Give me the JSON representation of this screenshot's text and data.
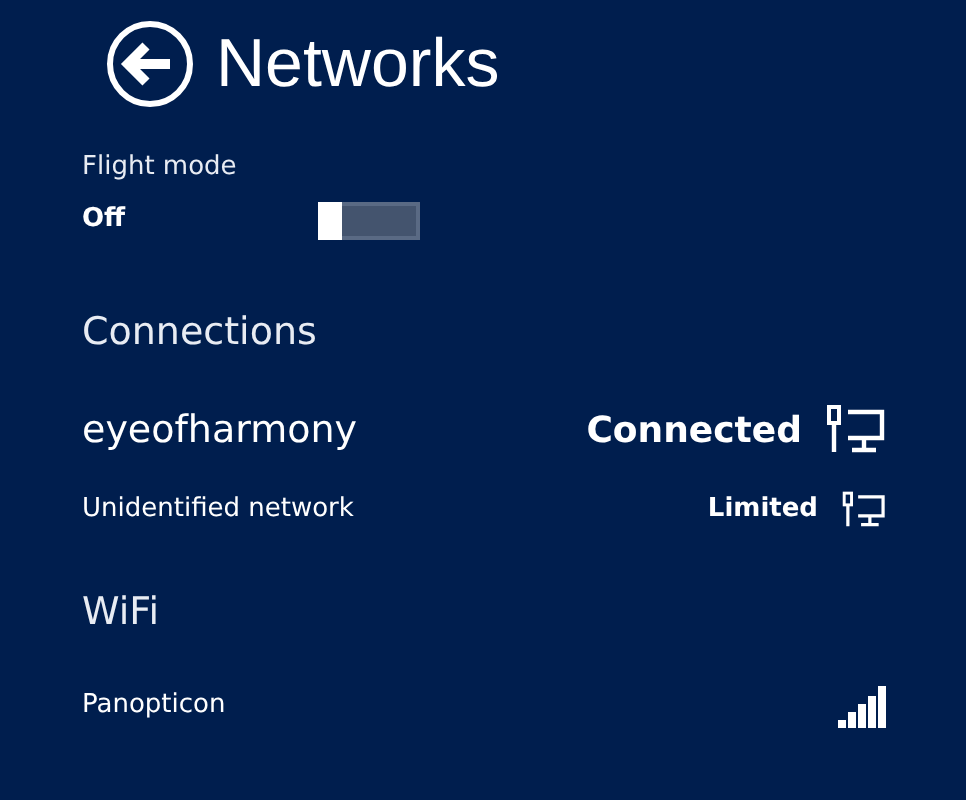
{
  "title": "Networks",
  "flight_mode": {
    "label": "Flight mode",
    "state_text": "Off",
    "on": false
  },
  "sections": [
    {
      "heading": "Connections",
      "items": [
        {
          "kind": "wired",
          "name": "eyeofharmony",
          "status": "Connected",
          "emphasis": true
        },
        {
          "kind": "wired",
          "name": "Unidentified network",
          "status": "Limited",
          "emphasis": false
        }
      ]
    },
    {
      "heading": "WiFi",
      "items": [
        {
          "kind": "wifi",
          "name": "Panopticon",
          "emphasis": false
        }
      ]
    }
  ]
}
